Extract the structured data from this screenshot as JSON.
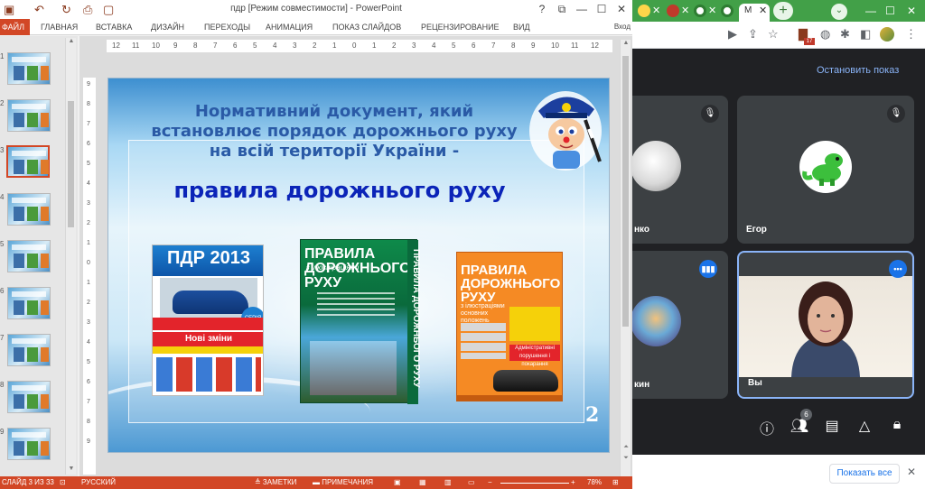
{
  "ppt": {
    "title": "пдр [Режим совместимости] - PowerPoint",
    "window_controls": [
      "?",
      "⧉",
      "—",
      "☐",
      "✕"
    ],
    "ribbon_tabs": [
      "ФАЙЛ",
      "ГЛАВНАЯ",
      "ВСТАВКА",
      "ДИЗАЙН",
      "ПЕРЕХОДЫ",
      "АНИМАЦИЯ",
      "ПОКАЗ СЛАЙДОВ",
      "РЕЦЕНЗИРОВАНИЕ",
      "ВИД"
    ],
    "login": "Вход",
    "thumb_numbers": [
      "1",
      "2",
      "3",
      "4",
      "5",
      "6",
      "7",
      "8",
      "9"
    ],
    "hruler": [
      "12",
      "11",
      "10",
      "9",
      "8",
      "7",
      "6",
      "5",
      "4",
      "3",
      "2",
      "1",
      "0",
      "1",
      "2",
      "3",
      "4",
      "5",
      "6",
      "7",
      "8",
      "9",
      "10",
      "11",
      "12"
    ],
    "vruler": [
      "9",
      "8",
      "7",
      "6",
      "5",
      "4",
      "3",
      "2",
      "1",
      "0",
      "1",
      "2",
      "3",
      "4",
      "5",
      "6",
      "7",
      "8",
      "9"
    ],
    "slide": {
      "heading": "Нормативний документ, який встановлює порядок дорожнього руху на всій території України -",
      "answer": "правила дорожнього руху",
      "number": "2",
      "book1_title": "ПДР 2013",
      "book1_new": "Нові зміни",
      "book1_badge": "СЕРІЯ",
      "book2_title": "ПРАВИЛА ДОРОЖНЬОГО РУХУ",
      "book2_sub": "з ілюстраціями",
      "book2_spine": "ПРАВИЛА ДОРОЖНЬОГО РУХУ",
      "book3_title": "ПРАВИЛА ДОРОЖНЬОГО РУХУ",
      "book3_sub": "з ілюстраціями основних положень",
      "book3_red": "Адміністративні порушення і покарання"
    },
    "status": {
      "slide": "СЛАЙД 3 ИЗ 33",
      "lang": "РУССКИЙ",
      "notes": "≜ ЗАМЕТКИ",
      "comments": "▬ ПРИМЕЧАНИЯ",
      "zoom": "78%"
    }
  },
  "meet": {
    "active_tab": "М",
    "badge": "17",
    "stop_presenting": "Остановить показ",
    "tiles": [
      {
        "name": "нко",
        "muted": true
      },
      {
        "name": "Егор",
        "muted": true
      },
      {
        "name": "кин",
        "speaking": true
      },
      {
        "name": "Вы",
        "more": true
      }
    ],
    "participants_count": "6",
    "show_all": "Показать все",
    "colors": {
      "chrome_green": "#42a048",
      "meet_bg": "#202124",
      "tile_bg": "#3c4043",
      "accent": "#1a73e8",
      "ppt_accent": "#d24726"
    }
  }
}
